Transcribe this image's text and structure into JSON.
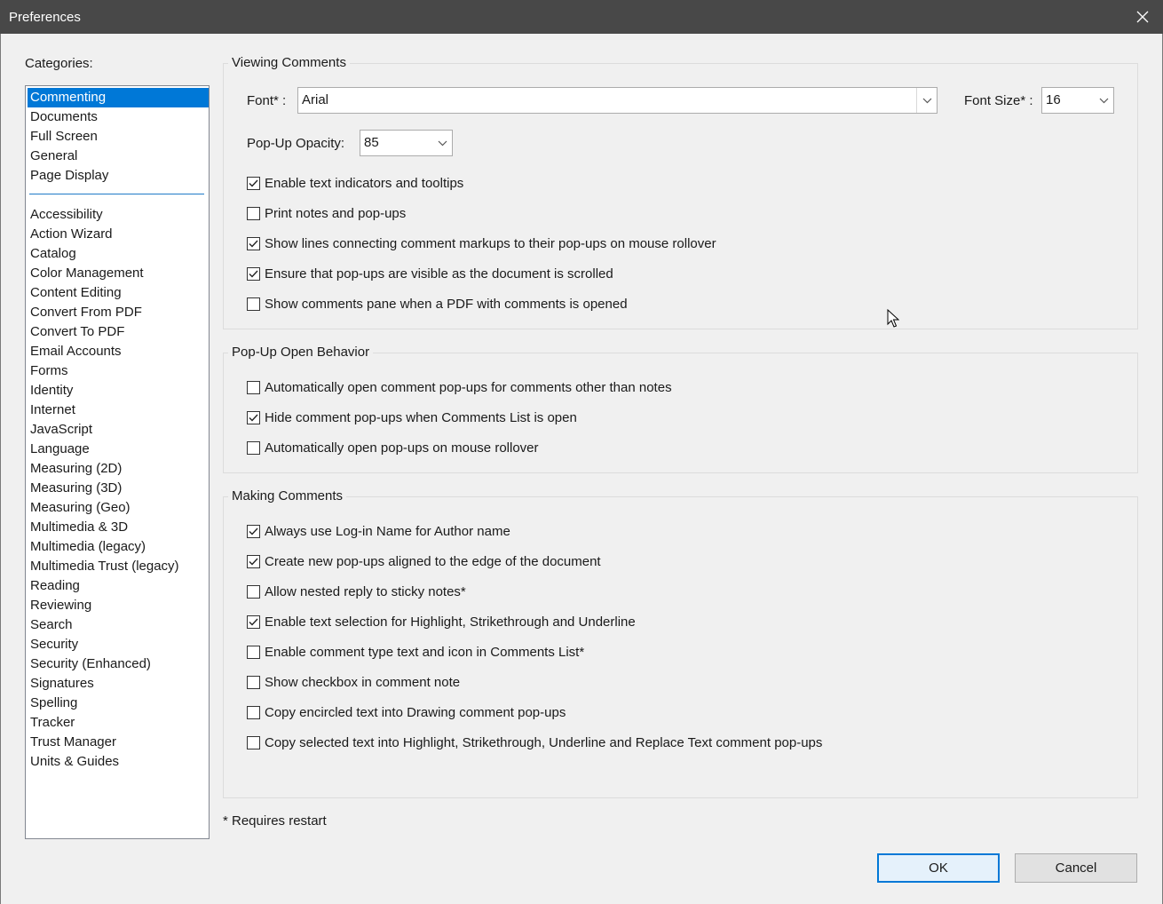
{
  "window": {
    "title": "Preferences"
  },
  "categories": {
    "label": "Categories:",
    "top_items": [
      "Commenting",
      "Documents",
      "Full Screen",
      "General",
      "Page Display"
    ],
    "selected": "Commenting",
    "items": [
      "Accessibility",
      "Action Wizard",
      "Catalog",
      "Color Management",
      "Content Editing",
      "Convert From PDF",
      "Convert To PDF",
      "Email Accounts",
      "Forms",
      "Identity",
      "Internet",
      "JavaScript",
      "Language",
      "Measuring (2D)",
      "Measuring (3D)",
      "Measuring (Geo)",
      "Multimedia & 3D",
      "Multimedia (legacy)",
      "Multimedia Trust (legacy)",
      "Reading",
      "Reviewing",
      "Search",
      "Security",
      "Security (Enhanced)",
      "Signatures",
      "Spelling",
      "Tracker",
      "Trust Manager",
      "Units & Guides"
    ]
  },
  "viewing": {
    "title": "Viewing Comments",
    "font_label": "Font* :",
    "font_value": "Arial",
    "font_size_label": "Font Size* :",
    "font_size_value": "16",
    "opacity_label": "Pop-Up Opacity:",
    "opacity_value": "85",
    "checks": [
      {
        "label": "Enable text indicators and tooltips",
        "checked": true
      },
      {
        "label": "Print notes and pop-ups",
        "checked": false
      },
      {
        "label": "Show lines connecting comment markups to their pop-ups on mouse rollover",
        "checked": true
      },
      {
        "label": "Ensure that pop-ups are visible as the document is scrolled",
        "checked": true
      },
      {
        "label": "Show comments pane when a PDF with comments is opened",
        "checked": false
      }
    ]
  },
  "popup": {
    "title": "Pop-Up Open Behavior",
    "checks": [
      {
        "label": "Automatically open comment pop-ups for comments other than notes",
        "checked": false
      },
      {
        "label": "Hide comment pop-ups when Comments List is open",
        "checked": true
      },
      {
        "label": "Automatically open pop-ups on mouse rollover",
        "checked": false
      }
    ]
  },
  "making": {
    "title": "Making Comments",
    "checks": [
      {
        "label": "Always use Log-in Name for Author name",
        "checked": true
      },
      {
        "label": "Create new pop-ups aligned to the edge of the document",
        "checked": true
      },
      {
        "label": "Allow nested reply to sticky notes*",
        "checked": false
      },
      {
        "label": "Enable text selection for Highlight, Strikethrough and Underline",
        "checked": true
      },
      {
        "label": "Enable comment type text and icon in Comments List*",
        "checked": false
      },
      {
        "label": "Show checkbox in comment note",
        "checked": false
      },
      {
        "label": "Copy encircled text into Drawing comment pop-ups",
        "checked": false
      },
      {
        "label": "Copy selected text into Highlight, Strikethrough, Underline and Replace Text comment pop-ups",
        "checked": false
      }
    ]
  },
  "footer": {
    "note": "* Requires restart",
    "ok_label": "OK",
    "cancel_label": "Cancel"
  },
  "icons": {
    "close": "close-icon",
    "dropdown": "chevron-down-icon",
    "check": "checkmark-icon",
    "cursor": "mouse-pointer-icon"
  },
  "colors": {
    "selection": "#0078d7",
    "titlebar": "#484848"
  }
}
